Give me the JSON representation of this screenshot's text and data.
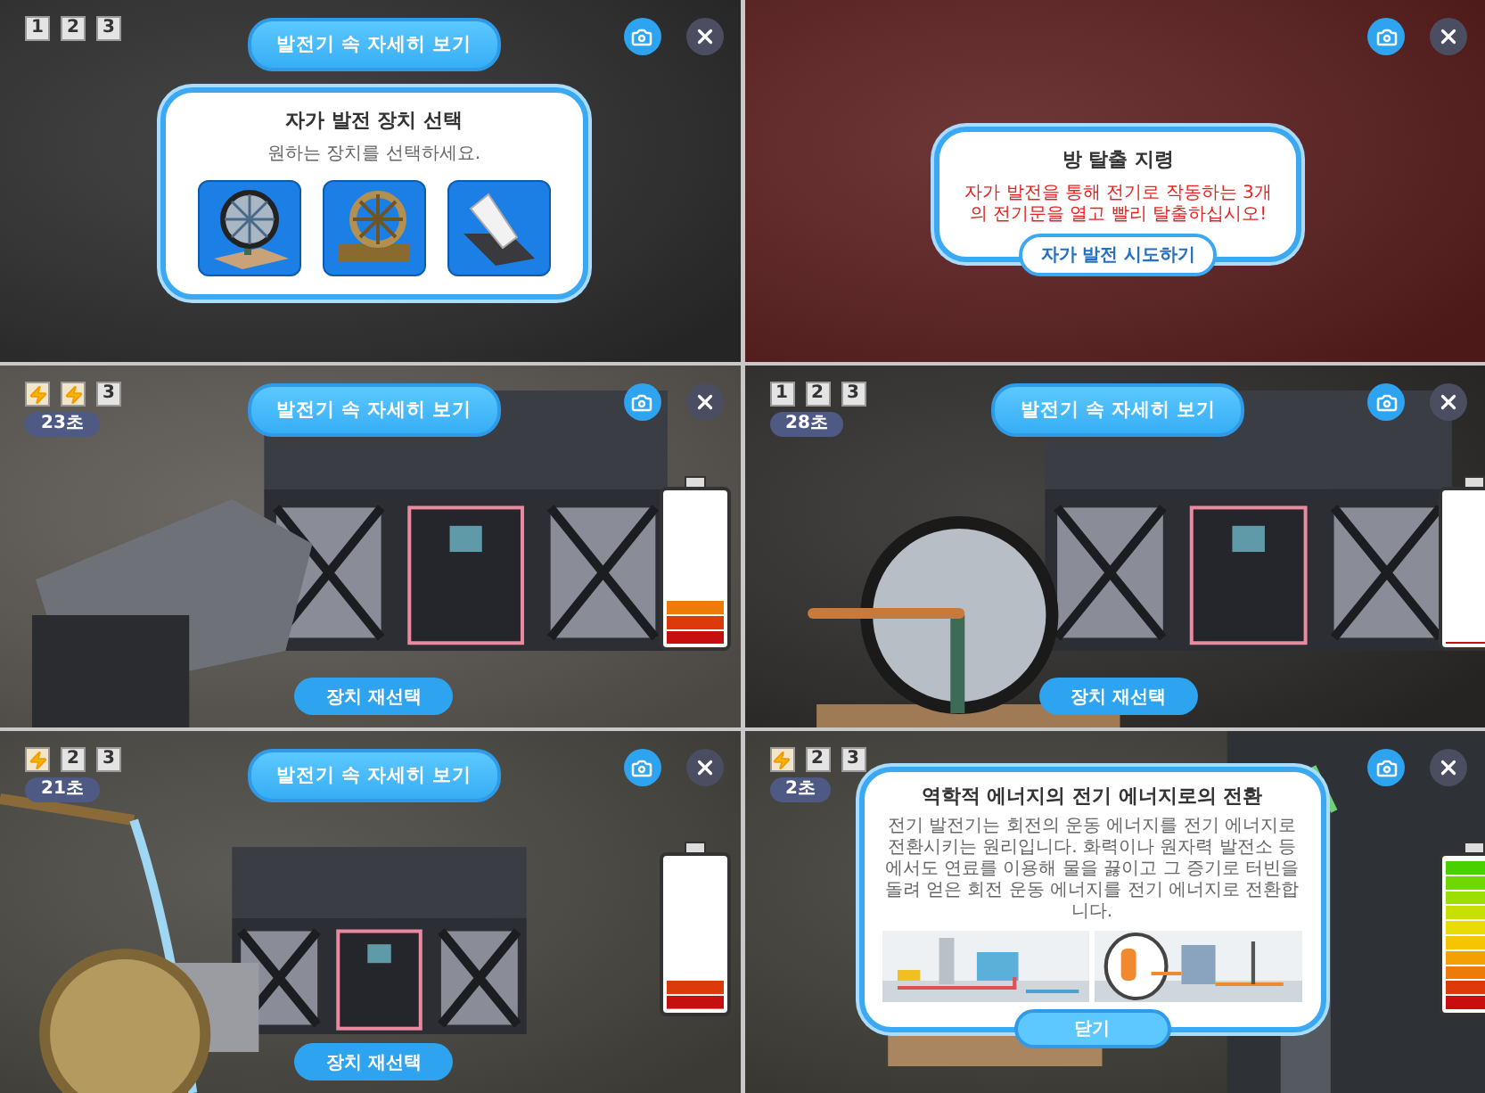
{
  "panels": [
    {
      "stages": [
        {
          "label": "1",
          "done": false
        },
        {
          "label": "2",
          "done": false
        },
        {
          "label": "3",
          "done": false
        }
      ],
      "title_button": "발전기 속 자세히 보기",
      "dialog": {
        "kind": "select",
        "title": "자가 발전 장치 선택",
        "subtitle": "원하는 장치를 선택하세요.",
        "options": [
          {
            "kind": "handwheel"
          },
          {
            "kind": "waterwheel"
          },
          {
            "kind": "pedal"
          }
        ]
      }
    },
    {
      "dialog": {
        "kind": "mission",
        "title": "방 탈출 지령",
        "message": "자가 발전을 통해 전기로 작동하는 3개의 전기문을 열고 빨리 탈출하십시오!",
        "button": "자가 발전 시도하기"
      }
    },
    {
      "stages": [
        {
          "done": true
        },
        {
          "done": true
        },
        {
          "label": "3",
          "done": false
        }
      ],
      "timer": "23초",
      "title_button": "발전기 속 자세히 보기",
      "battery": {
        "level": 0.3
      },
      "reselect_button": "장치 재선택"
    },
    {
      "stages": [
        {
          "label": "1",
          "done": false
        },
        {
          "label": "2",
          "done": false
        },
        {
          "label": "3",
          "done": false
        }
      ],
      "timer": "28초",
      "title_button": "발전기 속 자세히 보기",
      "battery": {
        "level": 0
      },
      "reselect_button": "장치 재선택"
    },
    {
      "stages": [
        {
          "done": true
        },
        {
          "label": "2",
          "done": false
        },
        {
          "label": "3",
          "done": false
        }
      ],
      "timer": "21초",
      "title_button": "발전기 속 자세히 보기",
      "battery": {
        "level": 0.2
      },
      "reselect_button": "장치 재선택"
    },
    {
      "stages": [
        {
          "done": true
        },
        {
          "label": "2",
          "done": false
        },
        {
          "label": "3",
          "done": false
        }
      ],
      "timer": "2초",
      "battery": {
        "level": 1
      },
      "dialog": {
        "kind": "info",
        "title": "역학적 에너지의 전기 에너지로의 전환",
        "body": "전기 발전기는 회전의 운동 에너지를 전기 에너지로 전환시키는 원리입니다. 화력이나 원자력 발전소 등에서도 연료를 이용해 물을 끓이고 그 증기로 터빈을 돌려 얻은 회전 운동 에너지를 전기 에너지로 전환합니다.",
        "button": "닫기"
      }
    }
  ]
}
